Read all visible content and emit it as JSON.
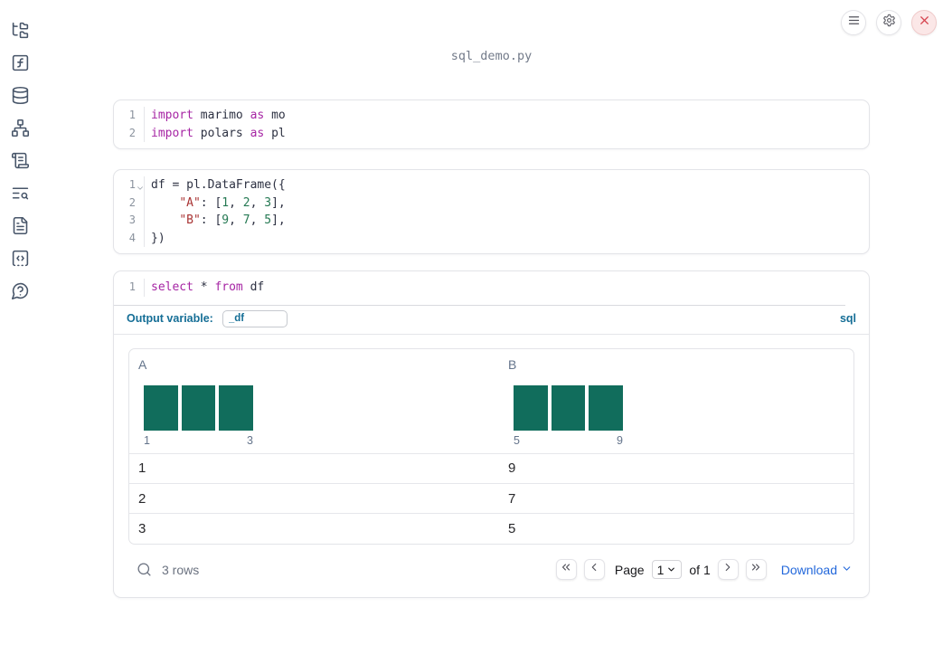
{
  "colors": {
    "keyword": "#a625a4",
    "string": "#a93434",
    "number": "#257953",
    "bar": "#116d5c",
    "accent": "#156e96",
    "link": "#2368db",
    "icon": "#475569",
    "close_red": "#d64550"
  },
  "window": {
    "filename": "sql_demo.py",
    "toolbar_icons": [
      "menu",
      "settings",
      "close"
    ]
  },
  "sidebar": {
    "icons": [
      "file-tree",
      "function-square",
      "database",
      "dependency-graph",
      "scroll",
      "list-search",
      "document",
      "code-brackets",
      "help-circle"
    ]
  },
  "cells": {
    "imports": {
      "lines": [
        {
          "num": "1",
          "tokens": [
            "import",
            " marimo ",
            "as",
            " mo"
          ]
        },
        {
          "num": "2",
          "tokens": [
            "import",
            " polars ",
            "as",
            " pl"
          ]
        }
      ]
    },
    "dataframe": {
      "lines": [
        {
          "num": "1",
          "tokens": [
            "df = pl.DataFrame({"
          ]
        },
        {
          "num": "2",
          "tokens": [
            "    ",
            "\"A\"",
            ": [",
            "1",
            ", ",
            "2",
            ", ",
            "3",
            "],"
          ]
        },
        {
          "num": "3",
          "tokens": [
            "    ",
            "\"B\"",
            ": [",
            "9",
            ", ",
            "7",
            ", ",
            "5",
            "],"
          ]
        },
        {
          "num": "4",
          "tokens": [
            "})"
          ]
        }
      ]
    },
    "sql": {
      "lines": [
        {
          "num": "1",
          "tokens": [
            "select",
            " * ",
            "from",
            " df"
          ]
        }
      ],
      "output_variable_label": "Output variable:",
      "output_variable_value": "_df",
      "language_badge": "sql"
    }
  },
  "table": {
    "columns": [
      {
        "header": "A",
        "hist": {
          "type": "bar",
          "values": [
            1,
            1,
            1
          ],
          "min_label": "1",
          "max_label": "3"
        }
      },
      {
        "header": "B",
        "hist": {
          "type": "bar",
          "values": [
            1,
            1,
            1
          ],
          "min_label": "5",
          "max_label": "9"
        }
      }
    ],
    "rows": [
      [
        "1",
        "9"
      ],
      [
        "2",
        "7"
      ],
      [
        "3",
        "5"
      ]
    ],
    "footer": {
      "row_count": "3 rows",
      "page_label": "Page",
      "page_value": "1",
      "page_total": "of 1",
      "download_label": "Download"
    }
  }
}
